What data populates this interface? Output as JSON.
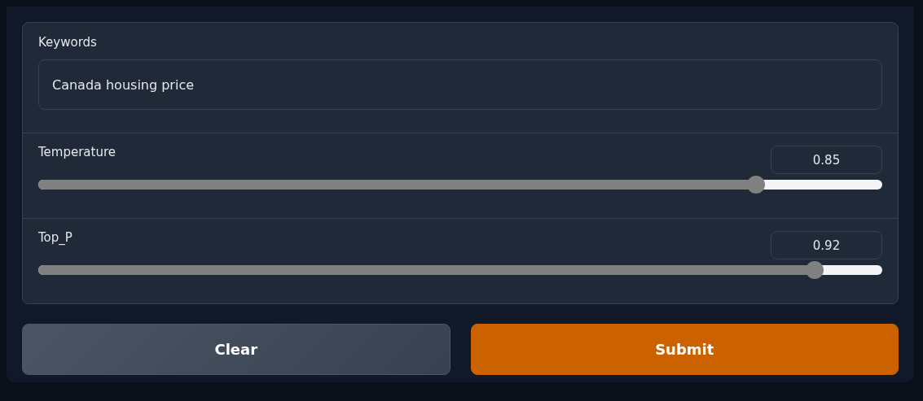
{
  "keywords": {
    "label": "Keywords",
    "value": "Canada housing price"
  },
  "sliders": [
    {
      "label": "Temperature",
      "value": "0.85",
      "level": 0.85
    },
    {
      "label": "Top_P",
      "value": "0.92",
      "level": 0.92
    }
  ],
  "buttons": [
    {
      "label": "Clear",
      "kind": "secondary"
    },
    {
      "label": "Submit",
      "kind": "primary"
    }
  ]
}
